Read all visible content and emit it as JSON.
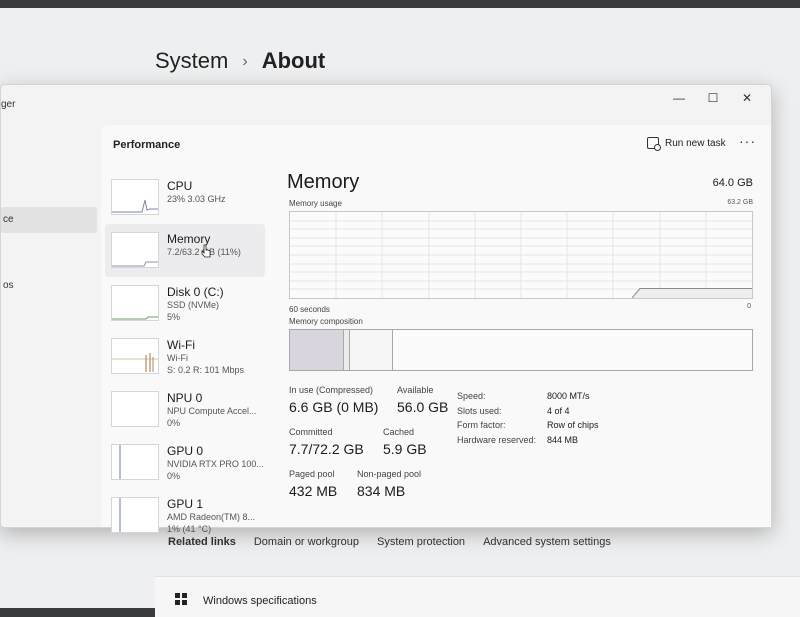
{
  "settings": {
    "breadcrumb_root": "System",
    "breadcrumb_separator": "›",
    "breadcrumb_current": "About",
    "related_links_title": "Related links",
    "related_links": [
      "Domain or workgroup",
      "System protection",
      "Advanced system settings"
    ],
    "windows_spec_label": "Windows specifications"
  },
  "task_manager": {
    "title_fragment": "ger",
    "window_controls": {
      "minimize": "—",
      "maximize": "☐",
      "close": "✕"
    },
    "left_nav_fragments": [
      "ce",
      "",
      "os"
    ],
    "header": {
      "title": "Performance",
      "run_new_task": "Run new task",
      "more": "···"
    },
    "resources": [
      {
        "name": "CPU",
        "sub1": "23%  3.03 GHz",
        "sub2": "",
        "icon": "cpu-graph"
      },
      {
        "name": "Memory",
        "sub1": "7.2/63.2 GB (11%)",
        "sub2": "",
        "icon": "memory-graph"
      },
      {
        "name": "Disk 0 (C:)",
        "sub1": "SSD (NVMe)",
        "sub2": "5%",
        "icon": "disk-graph"
      },
      {
        "name": "Wi-Fi",
        "sub1": "Wi-Fi",
        "sub2": "S: 0.2  R: 101 Mbps",
        "icon": "wifi-graph"
      },
      {
        "name": "NPU 0",
        "sub1": "NPU Compute Accel...",
        "sub2": "0%",
        "icon": "npu-graph"
      },
      {
        "name": "GPU 0",
        "sub1": "NVIDIA RTX PRO 100...",
        "sub2": "0%",
        "icon": "gpu-graph"
      },
      {
        "name": "GPU 1",
        "sub1": "AMD Radeon(TM) 8...",
        "sub2": "1% (41 °C)",
        "icon": "gpu-graph"
      }
    ],
    "memory": {
      "title": "Memory",
      "total": "64.0 GB",
      "usage_label": "Memory usage",
      "usage_max": "63.2 GB",
      "axis_left": "60 seconds",
      "axis_right": "0",
      "composition_label": "Memory composition",
      "composition": {
        "in_use_fraction": 0.115,
        "modified_fraction": 0.01,
        "standby_fraction": 0.09
      },
      "in_use_label": "In use (Compressed)",
      "in_use_value": "6.6 GB (0 MB)",
      "available_label": "Available",
      "available_value": "56.0 GB",
      "committed_label": "Committed",
      "committed_value": "7.7/72.2 GB",
      "cached_label": "Cached",
      "cached_value": "5.9 GB",
      "paged_label": "Paged pool",
      "paged_value": "432 MB",
      "nonpaged_label": "Non-paged pool",
      "nonpaged_value": "834 MB",
      "specs": [
        {
          "key": "Speed:",
          "value": "8000 MT/s"
        },
        {
          "key": "Slots used:",
          "value": "4 of 4"
        },
        {
          "key": "Form factor:",
          "value": "Row of chips"
        },
        {
          "key": "Hardware reserved:",
          "value": "844 MB"
        }
      ],
      "usage_level_fraction": 0.11
    }
  },
  "colors": {
    "accent_graph": "#8a8a8a",
    "panel_bg": "#f9f9f9",
    "window_bg": "#f3f3f3",
    "composition_in_use": "#d8d5de"
  }
}
